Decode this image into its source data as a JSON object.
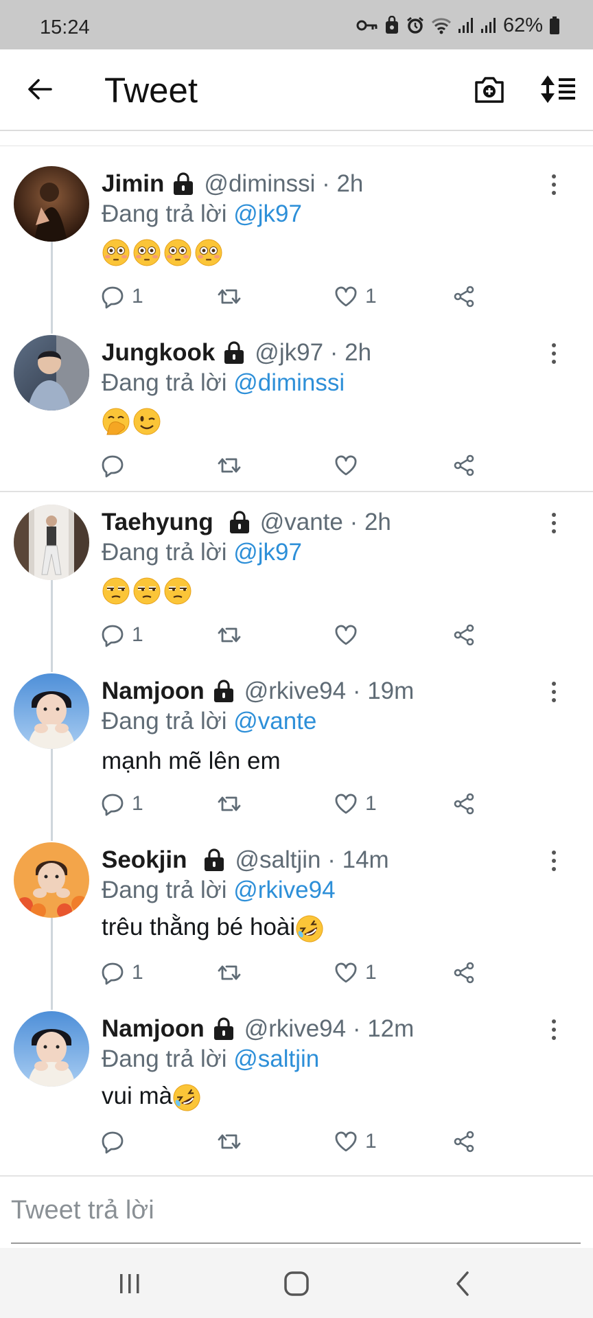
{
  "status_bar": {
    "time": "15:24",
    "battery": "62%",
    "icons": [
      "key-icon",
      "bag-icon",
      "alarm-icon",
      "wifi-icon",
      "signal-icon",
      "signal-icon",
      "battery-icon"
    ]
  },
  "header": {
    "title": "Tweet",
    "icons": [
      "back-arrow-icon",
      "camera-add-icon",
      "sort-icon"
    ]
  },
  "tweets": [
    {
      "name": "Jimin",
      "handle": "@diminssi · 2h",
      "reply_prefix": "Đang trả lời",
      "reply_to": "@jk97",
      "text": "",
      "emojis": [
        "flushed",
        "flushed",
        "flushed",
        "flushed"
      ],
      "replies": "1",
      "retweets": "",
      "likes": "1"
    },
    {
      "name": "Jungkook",
      "handle": "@jk97 · 2h",
      "reply_prefix": "Đang trả lời",
      "reply_to": "@diminssi",
      "text": "",
      "emojis": [
        "face-hand-over-mouth",
        "winking"
      ],
      "replies": "",
      "retweets": "",
      "likes": ""
    },
    {
      "name": "Taehyung",
      "handle": "@vante · 2h",
      "reply_prefix": "Đang trả lời",
      "reply_to": "@jk97",
      "text": "",
      "emojis": [
        "unamused",
        "unamused",
        "unamused"
      ],
      "replies": "1",
      "retweets": "",
      "likes": ""
    },
    {
      "name": "Namjoon",
      "handle": "@rkive94 · 19m",
      "reply_prefix": "Đang trả lời",
      "reply_to": "@vante",
      "text": "mạnh mẽ lên em",
      "emojis": [],
      "replies": "1",
      "retweets": "",
      "likes": "1"
    },
    {
      "name": "Seokjin",
      "handle": "@saltjin · 14m",
      "reply_prefix": "Đang trả lời",
      "reply_to": "@rkive94",
      "text": "trêu thằng bé hoài",
      "emojis": [
        "rolling-on-floor-laughing"
      ],
      "replies": "1",
      "retweets": "",
      "likes": "1"
    },
    {
      "name": "Namjoon",
      "handle": "@rkive94 · 12m",
      "reply_prefix": "Đang trả lời",
      "reply_to": "@saltjin",
      "text": "vui mà",
      "emojis": [
        "rolling-on-floor-laughing"
      ],
      "replies": "",
      "retweets": "",
      "likes": "1"
    }
  ],
  "reply_input": {
    "placeholder": "Tweet trả lời",
    "value": ""
  },
  "nav": {
    "icons": [
      "recent-apps-icon",
      "home-icon",
      "back-icon"
    ]
  },
  "colors": {
    "accent": "#2d8fd8",
    "secondary_text": "#5f6b75",
    "status_bar": "#c9c9c9"
  }
}
